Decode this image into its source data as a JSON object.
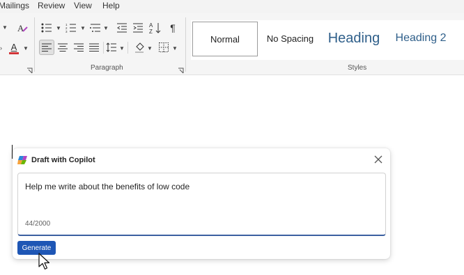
{
  "menu": {
    "mailings": "Mailings",
    "review": "Review",
    "view": "View",
    "help": "Help"
  },
  "ribbon": {
    "paragraph_group_label": "Paragraph",
    "styles_group_label": "Styles",
    "font_color_letter": "A",
    "font_color_hex": "#d13438"
  },
  "styles": {
    "normal": "Normal",
    "no_spacing": "No Spacing",
    "heading1": "Heading",
    "heading2": "Heading 2"
  },
  "copilot": {
    "title": "Draft with Copilot",
    "prompt": "Help me write about the benefits of low code",
    "counter": "44/2000",
    "generate_label": "Generate"
  },
  "colors": {
    "accent": "#1e56b5",
    "heading_blue": "#2f5f8a"
  }
}
